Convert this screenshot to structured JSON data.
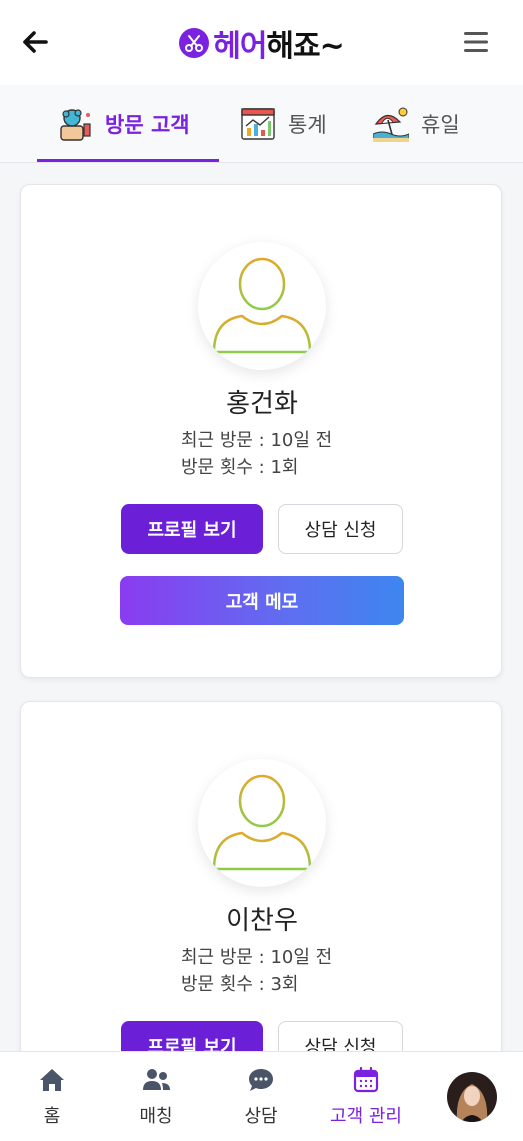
{
  "header": {
    "logo_text_part1": "헤어",
    "logo_text_part2": "해죠~",
    "colors": {
      "brand": "#7b22e0",
      "memo_gradient_start": "#8a3cf0",
      "memo_gradient_end": "#3d86f0"
    }
  },
  "tabs": [
    {
      "label": "방문 고객",
      "icon": "stylist-icon",
      "active": true
    },
    {
      "label": "통계",
      "icon": "chart-icon",
      "active": false
    },
    {
      "label": "휴일",
      "icon": "beach-umbrella-icon",
      "active": false
    }
  ],
  "customers": [
    {
      "name": "홍건화",
      "recent_visit": "최근 방문 : 10일 전",
      "visit_count": "방문 횟수 : 1회"
    },
    {
      "name": "이찬우",
      "recent_visit": "최근 방문 : 10일 전",
      "visit_count": "방문 횟수 : 3회"
    }
  ],
  "card_buttons": {
    "profile": "프로필 보기",
    "consult": "상담 신청",
    "memo": "고객 메모"
  },
  "bottom_nav": [
    {
      "label": "홈",
      "icon": "home-icon",
      "active": false
    },
    {
      "label": "매칭",
      "icon": "users-icon",
      "active": false
    },
    {
      "label": "상담",
      "icon": "chat-icon",
      "active": false
    },
    {
      "label": "고객 관리",
      "icon": "calendar-icon",
      "active": true
    }
  ]
}
